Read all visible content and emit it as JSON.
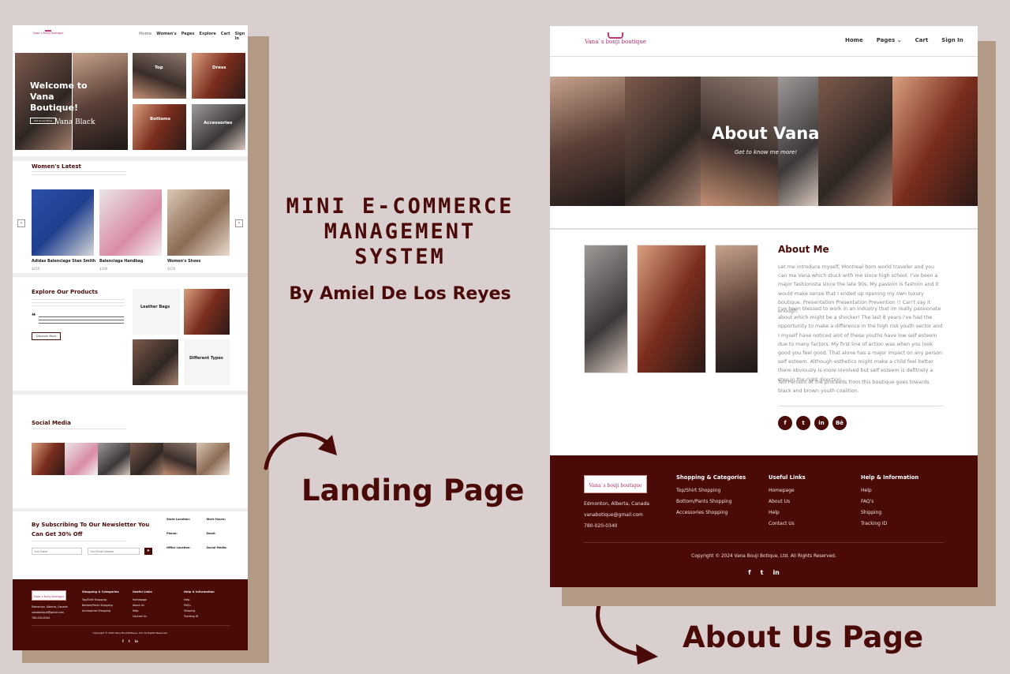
{
  "center": {
    "title_line1": "MINI E-COMMERCE",
    "title_line2": "MANAGEMENT",
    "title_line3": "SYSTEM",
    "author": "By Amiel De Los Reyes",
    "landing_label": "Landing Page",
    "about_label": "About Us Page"
  },
  "brand": {
    "logo_text": "Vana`s bouji boutique",
    "maroon": "#4a0a08",
    "background": "#d9cfcf",
    "shadow": "#b29a86"
  },
  "landing": {
    "nav": [
      "Home",
      "Women's",
      "Pages",
      "Explore",
      "Cart",
      "Sign In"
    ],
    "hero": {
      "welcome": "Welcome to Vana Boutique!",
      "cta": "Get Know More",
      "caption": "Vana Black",
      "tiles": [
        "Top",
        "Dress",
        "Bottoms",
        "Accessories"
      ]
    },
    "latest": {
      "heading": "Women's Latest",
      "products": [
        {
          "name": "Adidas Balenciage Stan Smith",
          "price": "$250"
        },
        {
          "name": "Balenciaga Handbag",
          "price": "$300"
        },
        {
          "name": "Women's Shoes",
          "price": "$150"
        }
      ]
    },
    "explore": {
      "heading": "Explore Our Products",
      "button": "Discover More",
      "card1_title": "Leather Bags",
      "card2_title": "Different Types"
    },
    "social": {
      "heading": "Social Media"
    },
    "newsletter": {
      "heading_line1": "By Subscribing To Our Newsletter You",
      "heading_line2": "Can Get 30% Off",
      "name_placeholder": "Your Name",
      "email_placeholder": "Your Email Address",
      "info": [
        {
          "label": "Store Location:",
          "value": ""
        },
        {
          "label": "Work Hours:",
          "value": ""
        },
        {
          "label": "Phone:",
          "value": ""
        },
        {
          "label": "Email:",
          "value": ""
        },
        {
          "label": "Office Location:",
          "value": ""
        },
        {
          "label": "Social Media:",
          "value": ""
        }
      ]
    },
    "footer": {
      "address": "Edmonton, Alberta, Canada",
      "email": "vanabotique@gmail.com",
      "phone": "780-020-0340",
      "col1_title": "Shopping & Categories",
      "col1": [
        "Top/Shirt Shopping",
        "Bottom/Pants Shopping",
        "Accessories Shopping"
      ],
      "col2_title": "Useful Links",
      "col2": [
        "Homepage",
        "About Us",
        "Help",
        "Contact Us"
      ],
      "col3_title": "Help & Information",
      "col3": [
        "Help",
        "FAQ's",
        "Shipping",
        "Tracking ID"
      ],
      "copyright": "Copyright © 2024 Vana Bouji Botique, Ltd. All Rights Reserved."
    }
  },
  "about": {
    "nav": [
      "Home",
      "Pages",
      "Cart",
      "Sign In"
    ],
    "hero_title": "About Vana",
    "hero_subtitle": "Get to know me more!",
    "about_heading": "About Me",
    "para1": "Let me introduce myself, Montreal born world traveler and you can me Vana which stuck with me since high school. I've been a major fashionista since the late 90s. My passion is fashion and it would make sense that I ended up opening my own luxury boutique. Presentation Presentation Prevention !! Can't say it enough.",
    "para2": "I've been blessed to work in an industry that im really passionate about which might be a shocker! The last 8 years i've had the opportunity to make a difference in the high risk youth sector and I myself have noticed alot of these youths have low self esteem due to many factors. My first line of action was when you look good you feel good. That alone has a major impact on any person self esteem. Although esthetics might make a child feel better there obviously is more involved but self esteem is defitnely a step in the right direction.",
    "para3": "Ten Percent of the proceeds from this boutique goes towards black and brown youth coalition.",
    "social_buttons": [
      "f",
      "t",
      "in",
      "Bē"
    ],
    "footer": {
      "address": "Edmonton, Alberta, Canada",
      "email": "vanabotique@gmail.com",
      "phone": "780-020-0340",
      "col1_title": "Shopping & Categories",
      "col1": [
        "Top/Shirt Shopping",
        "Bottom/Pants Shopping",
        "Accessories Shopping"
      ],
      "col2_title": "Useful Links",
      "col2": [
        "Homepage",
        "About Us",
        "Help",
        "Contact Us"
      ],
      "col3_title": "Help & Information",
      "col3": [
        "Help",
        "FAQ's",
        "Shipping",
        "Tracking ID"
      ],
      "copyright": "Copyright © 2024 Vana Bouji Botique, Ltd. All Rights Reserved.",
      "icons": [
        "f",
        "t",
        "in"
      ]
    }
  }
}
